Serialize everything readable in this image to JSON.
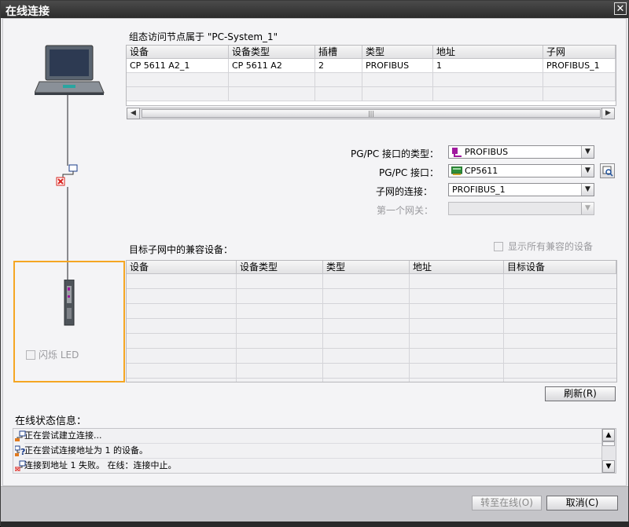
{
  "window": {
    "title": "在线连接",
    "close_glyph": "✕"
  },
  "config_section": {
    "title": "组态访问节点属于 \"PC-System_1\"",
    "columns": [
      "设备",
      "设备类型",
      "插槽",
      "类型",
      "地址",
      "子网"
    ],
    "rows": [
      [
        "CP 5611 A2_1",
        "CP 5611 A2",
        "2",
        "PROFIBUS",
        "1",
        "PROFIBUS_1"
      ]
    ]
  },
  "interface": {
    "pgpc_type_label": "PG/PC 接口的类型：",
    "pgpc_type_value": "PROFIBUS",
    "pgpc_if_label": "PG/PC 接口：",
    "pgpc_if_value": "CP5611",
    "subnet_conn_label": "子网的连接：",
    "subnet_conn_value": "PROFIBUS_1",
    "first_gateway_label": "第一个网关：",
    "first_gateway_value": ""
  },
  "compatible_section": {
    "title": "目标子网中的兼容设备：",
    "show_all_label": "显示所有兼容的设备",
    "columns": [
      "设备",
      "设备类型",
      "类型",
      "地址",
      "目标设备"
    ]
  },
  "flash_led_label": "闪烁 LED",
  "refresh_button": "刷新(R)",
  "status_section": {
    "title": "在线状态信息：",
    "messages": [
      "正在尝试建立连接...",
      "正在尝试连接地址为 1 的设备。",
      "连接到地址 1 失败。 在线：连接中止。"
    ]
  },
  "go_online_button": "转至在线(O)",
  "cancel_button": "取消(C)",
  "colors": {
    "highlight_orange": "#f5a623",
    "profibus_purple": "#a0199e",
    "error_red": "#d9241f"
  }
}
